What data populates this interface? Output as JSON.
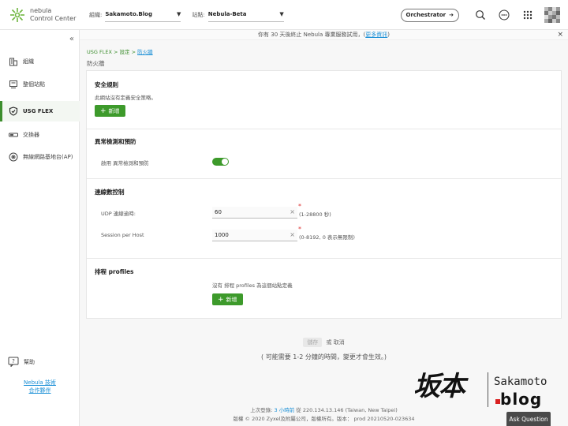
{
  "header": {
    "logo_line1": "nebula",
    "logo_line2": "Control Center",
    "org_label": "組織:",
    "org_value": "Sakamoto.Blog",
    "site_label": "站點:",
    "site_value": "Nebula-Beta",
    "orchestrator_label": "Orchestrator",
    "icons": [
      "search-icon",
      "more-icon",
      "apps-grid-icon",
      "avatar"
    ]
  },
  "banner": {
    "text": "你有 30 天後終止 Nebula 專業服務試用，",
    "link": "更多資訊",
    "close": "×"
  },
  "sidebar": {
    "collapse": "«",
    "items": [
      {
        "label": "組織",
        "icon": "building-icon"
      },
      {
        "label": "整個站點",
        "icon": "site-icon"
      },
      {
        "label": "USG FLEX",
        "icon": "shield-icon"
      },
      {
        "label": "交換器",
        "icon": "switch-icon"
      },
      {
        "label": "無線網路基地台(AP)",
        "icon": "ap-icon"
      }
    ],
    "help_label": "幫助",
    "link1": "Nebula 技術",
    "link2": "合作夥伴"
  },
  "breadcrumb": {
    "part1": "USG FLEX",
    "sep1": " > ",
    "part2": "設定",
    "sep2": " > ",
    "current": "防火牆"
  },
  "page_title": "防火牆",
  "security_policy": {
    "title": "安全規則",
    "empty_text": "此網站沒有定義安全策略。",
    "add_label": "新增"
  },
  "anomaly": {
    "title": "異常檢測和預防",
    "toggle_label": "啟用 異常檢測和預防",
    "enabled": true
  },
  "connection": {
    "title": "連線數控制",
    "udp_label": "UDP 連線逾時:",
    "udp_value": "60",
    "udp_hint": "(1-28800 秒)",
    "session_label": "Session per Host",
    "session_value": "1000",
    "session_hint": "(0-8192, 0 表示無限制)",
    "required_mark": "*",
    "clear_mark": "×"
  },
  "schedule": {
    "title": "排程 profiles",
    "empty_text": "沒有 排程 profiles 為這個站點定義",
    "add_label": "新增"
  },
  "actions": {
    "apply": "儲存",
    "or": "或",
    "cancel": "取消"
  },
  "note": "( 可能需要 1-2 分鐘的時間，變更才會生效。)",
  "footer": {
    "last_login_prefix": "上次登錄: ",
    "last_login_time": "3 小時前",
    "last_login_suffix": " 從 220.134.13.146 (Taiwan, New Taipei)",
    "copyright": "版權 © 2020 Zyxel及附屬公司，版權所有。版本： prod 20210520-023634"
  },
  "watermark": {
    "cn": "坂本",
    "en1": "Sakamoto",
    "en2": "blog"
  },
  "ask_question": "Ask Question",
  "colors": {
    "accent_green": "#3d9a2b",
    "link_blue": "#1a8fd6"
  }
}
